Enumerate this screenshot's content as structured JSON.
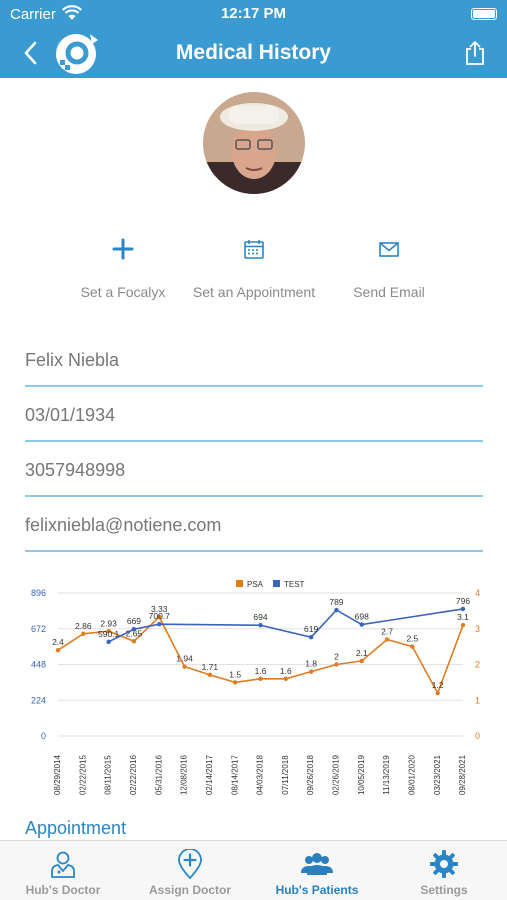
{
  "status": {
    "carrier": "Carrier",
    "time": "12:17 PM"
  },
  "nav": {
    "title": "Medical History"
  },
  "actions": [
    {
      "label": "Set a Focalyx",
      "icon": "plus-icon"
    },
    {
      "label": "Set an Appointment",
      "icon": "calendar-icon"
    },
    {
      "label": "Send Email",
      "icon": "mail-icon"
    }
  ],
  "patient": {
    "name": "Felix Niebla",
    "dob": "03/01/1934",
    "phone": "3057948998",
    "email": "felixniebla@notiene.com"
  },
  "colors": {
    "brand": "#3a9ad2",
    "psa": "#e07b22",
    "test": "#3a63c0",
    "field_line": "#8fc8e6"
  },
  "chart_data": {
    "type": "line",
    "legend": [
      "PSA",
      "TEST"
    ],
    "legend_placement": "top",
    "grid": true,
    "categories": [
      "08/29/2014",
      "02/22/2015",
      "08/11/2015",
      "02/22/2016",
      "05/31/2016",
      "12/08/2016",
      "02/14/2017",
      "08/14/2017",
      "04/03/2018",
      "07/11/2018",
      "09/26/2018",
      "02/26/2019",
      "10/05/2019",
      "11/13/2019",
      "08/01/2020",
      "03/23/2021",
      "09/28/2021"
    ],
    "left_axis": {
      "ticks": [
        "0",
        "224",
        "448",
        "672",
        "896"
      ],
      "ylim": [
        0,
        896
      ]
    },
    "right_axis": {
      "ticks": [
        "0",
        "1",
        "2",
        "3",
        "4"
      ],
      "ylim": [
        0,
        4
      ]
    },
    "series": [
      {
        "name": "PSA",
        "axis": "right",
        "points": [
          {
            "x": 0.0,
            "y": 2.4,
            "label": "2.4"
          },
          {
            "x": 1.0,
            "y": 2.86,
            "label": "2.86"
          },
          {
            "x": 2.0,
            "y": 2.93,
            "label": "2.93"
          },
          {
            "x": 3.0,
            "y": 2.65,
            "label": "2.65"
          },
          {
            "x": 4.0,
            "y": 3.33,
            "label": "3.33"
          },
          {
            "x": 5.0,
            "y": 1.94,
            "label": "1.94"
          },
          {
            "x": 6.0,
            "y": 1.71,
            "label": "1.71"
          },
          {
            "x": 7.0,
            "y": 1.5,
            "label": "1.5"
          },
          {
            "x": 8.0,
            "y": 1.6,
            "label": "1.6"
          },
          {
            "x": 9.0,
            "y": 1.6,
            "label": "1.6"
          },
          {
            "x": 10.0,
            "y": 1.8,
            "label": "1.8"
          },
          {
            "x": 11.0,
            "y": 2.0,
            "label": "2"
          },
          {
            "x": 12.0,
            "y": 2.1,
            "label": "2.1"
          },
          {
            "x": 13.0,
            "y": 2.7,
            "label": "2.7"
          },
          {
            "x": 14.0,
            "y": 2.5,
            "label": "2.5"
          },
          {
            "x": 15.0,
            "y": 1.2,
            "label": "1.2"
          },
          {
            "x": 16.0,
            "y": 3.1,
            "label": "3.1"
          }
        ]
      },
      {
        "name": "TEST",
        "axis": "left",
        "points": [
          {
            "x": 2.0,
            "y": 590.1,
            "label": "590.1"
          },
          {
            "x": 3.0,
            "y": 669,
            "label": "669"
          },
          {
            "x": 4.0,
            "y": 700.7,
            "label": "700.7"
          },
          {
            "x": 8.0,
            "y": 694,
            "label": "694"
          },
          {
            "x": 10.0,
            "y": 619,
            "label": "619"
          },
          {
            "x": 11.0,
            "y": 789,
            "label": "789"
          },
          {
            "x": 12.0,
            "y": 698,
            "label": "698"
          },
          {
            "x": 16.0,
            "y": 796,
            "label": "796"
          }
        ]
      }
    ]
  },
  "appointment": {
    "heading": "Appointment"
  },
  "tabs": [
    {
      "label": "Hub's Doctor",
      "icon": "doctor-icon",
      "active": false
    },
    {
      "label": "Assign Doctor",
      "icon": "map-pin-plus-icon",
      "active": false
    },
    {
      "label": "Hub's Patients",
      "icon": "patients-icon",
      "active": true
    },
    {
      "label": "Settings",
      "icon": "gear-icon",
      "active": false
    }
  ]
}
